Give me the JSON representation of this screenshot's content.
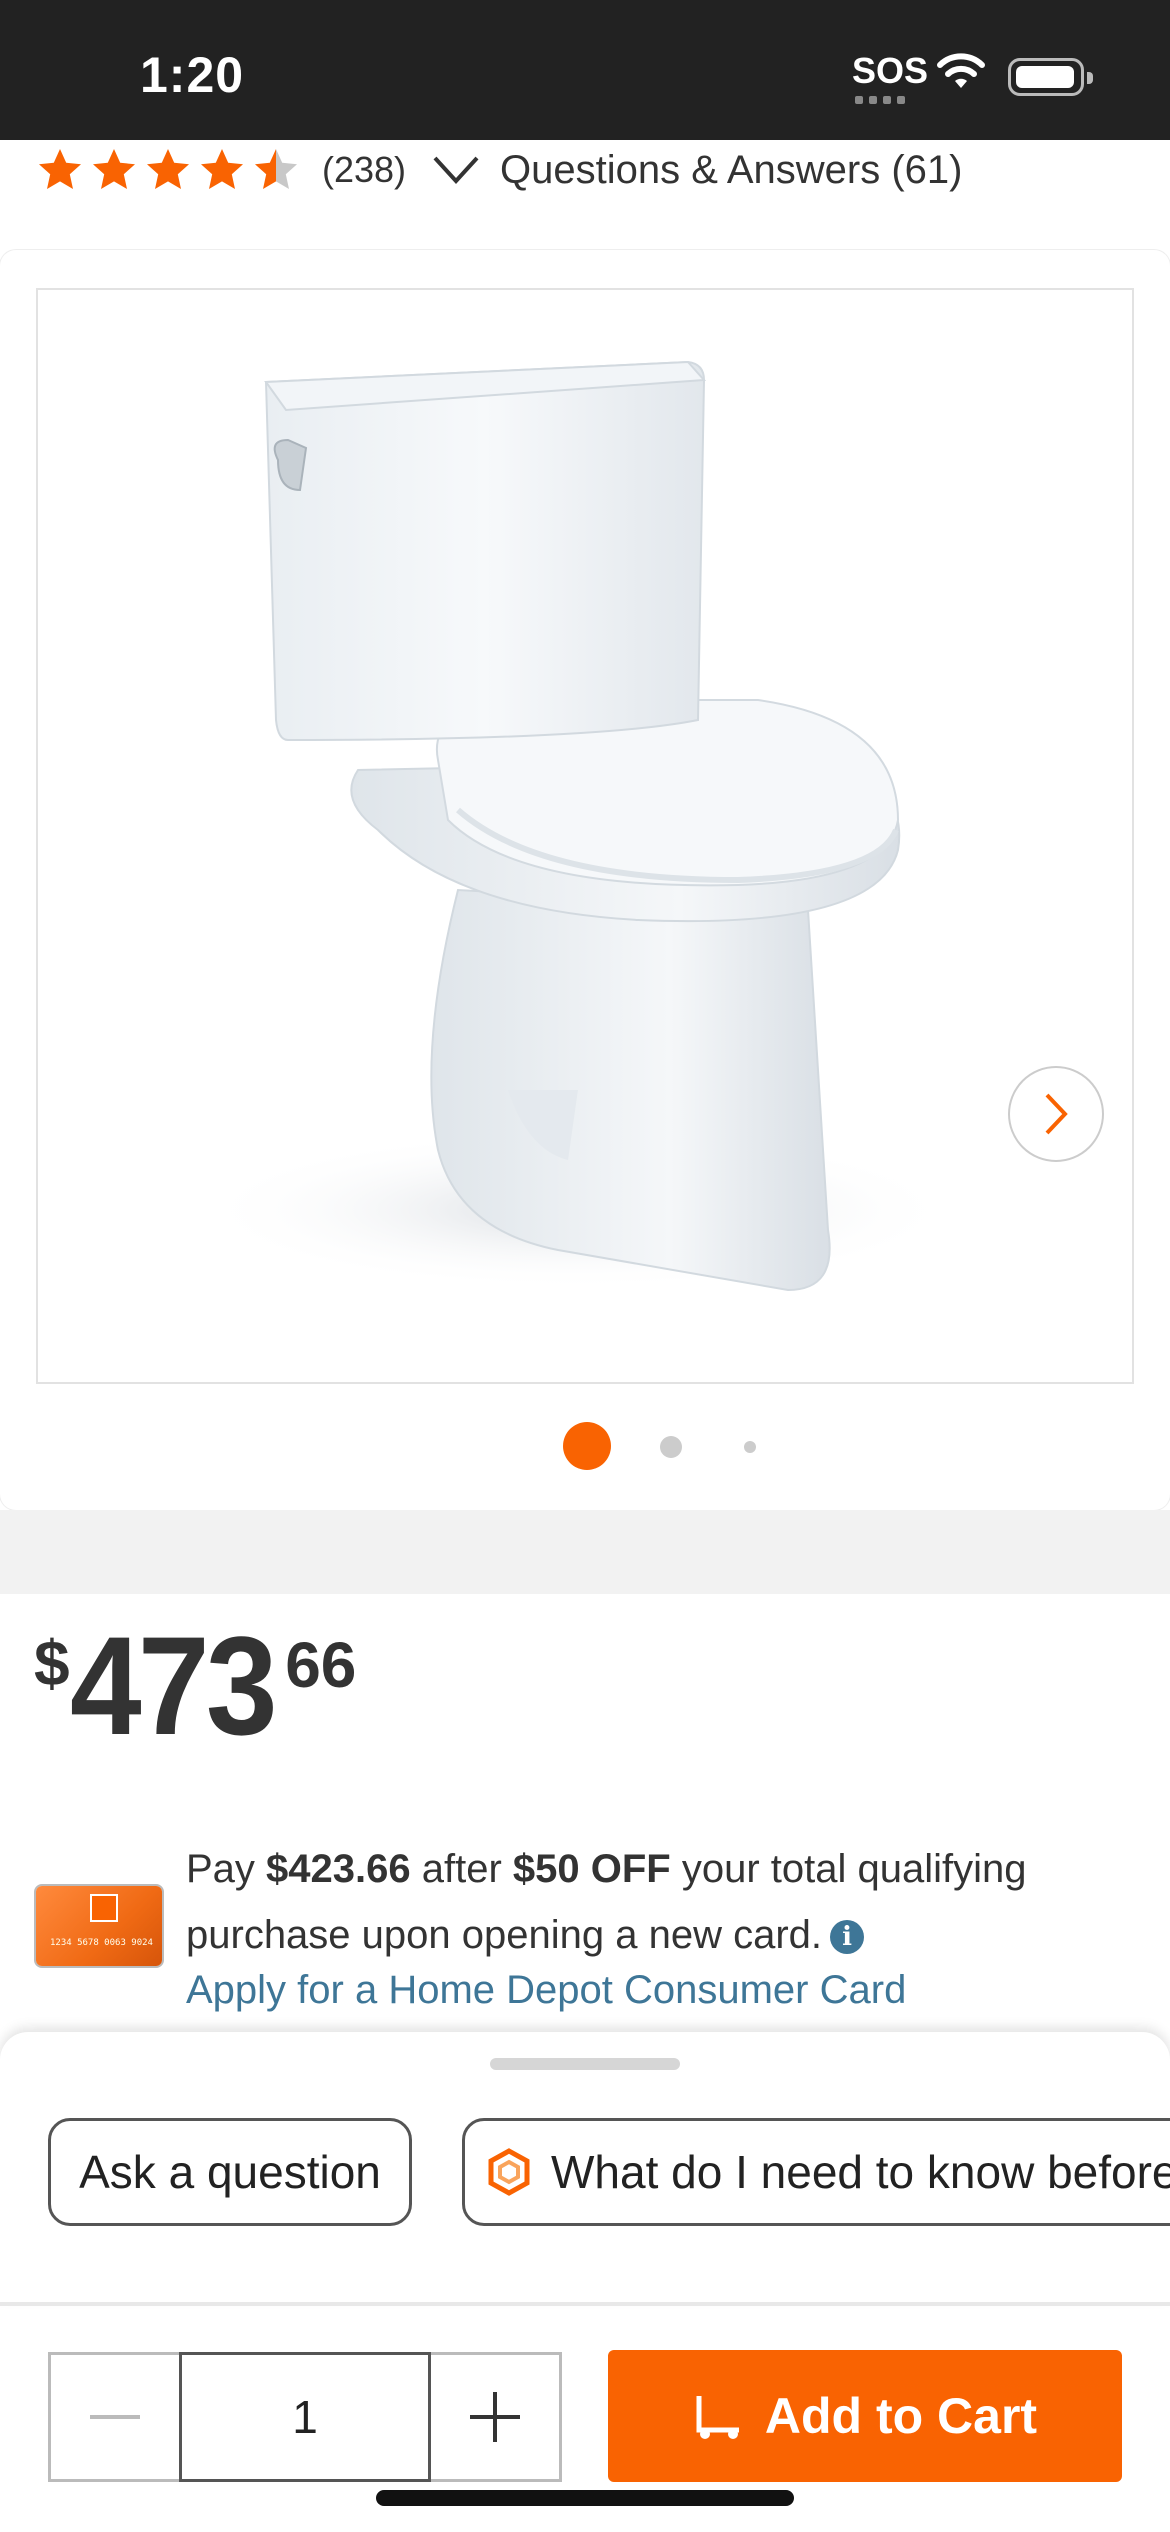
{
  "status_bar": {
    "time": "1:20",
    "sos": "SOS"
  },
  "rating": {
    "stars": 4.5,
    "review_count": "(238)",
    "qa_label": "Questions & Answers (61)"
  },
  "gallery": {
    "image_alt": "toilet product image",
    "pages": 3,
    "current_page": 1
  },
  "price": {
    "currency": "$",
    "dollars": "473",
    "cents": "66"
  },
  "promo": {
    "pay_prefix": "Pay ",
    "pay_amount": "$423.66",
    "after_text": " after ",
    "discount": "$50 OFF",
    "rest_text": " your total qualifying purchase upon opening a new card.",
    "apply_link": "Apply for a Home Depot Consumer Card",
    "card_number": "1234 5678 0063 9024"
  },
  "sheet": {
    "chips": [
      {
        "label": "Ask a question"
      },
      {
        "label": "What do I need to know before"
      }
    ]
  },
  "cart": {
    "quantity": "1",
    "add_label": "Add to Cart"
  },
  "colors": {
    "brand_orange": "#f96302",
    "link_blue": "#3e7697",
    "status_bar": "#222222"
  }
}
